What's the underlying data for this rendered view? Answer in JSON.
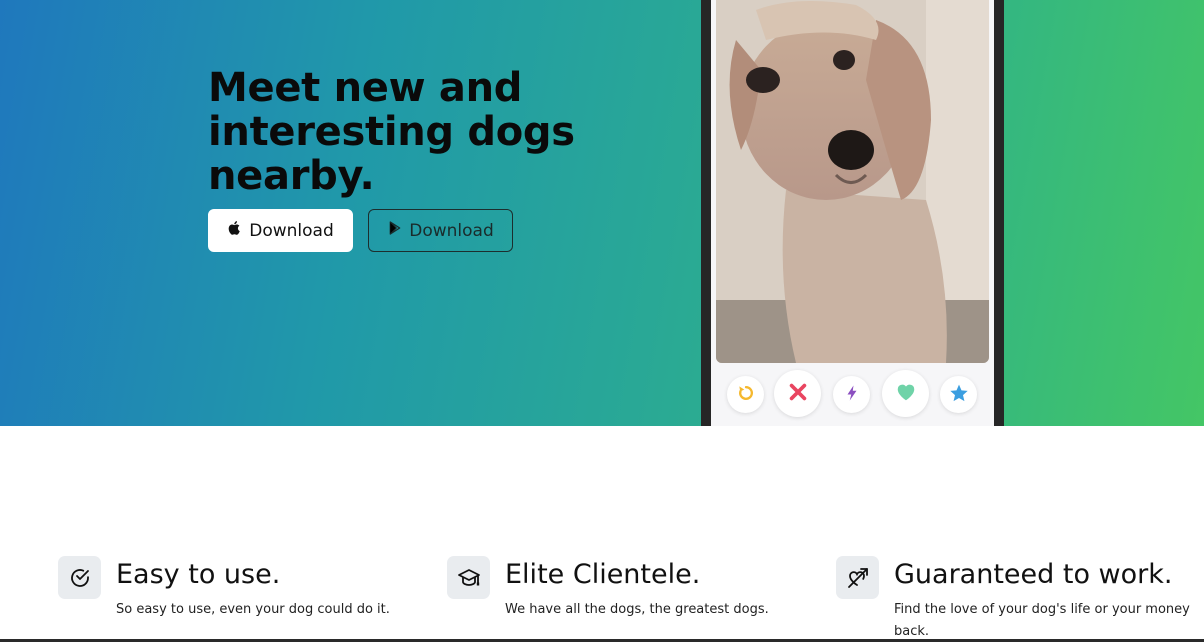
{
  "hero": {
    "title": "Meet new and interesting dogs nearby.",
    "apple_button_label": "Download",
    "play_button_label": "Download",
    "apple_icon": "apple-icon",
    "play_icon": "google-play-icon",
    "gradient_start": "#1f78bd",
    "gradient_end": "#44c665"
  },
  "phone": {
    "photo": "dog-photo",
    "actions": [
      {
        "name": "rewind-button",
        "icon": "rewind-icon",
        "color": "#f5b82e"
      },
      {
        "name": "nope-button",
        "icon": "close-icon",
        "color": "#e94560"
      },
      {
        "name": "boost-button",
        "icon": "lightning-icon",
        "color": "#8b4fc0"
      },
      {
        "name": "like-button",
        "icon": "heart-icon",
        "color": "#6fd3a8"
      },
      {
        "name": "super-like-button",
        "icon": "star-icon",
        "color": "#3b9ee0"
      }
    ]
  },
  "features": [
    {
      "icon": "check-circle-icon",
      "title": "Easy to use.",
      "text": "So easy to use, even your dog could do it."
    },
    {
      "icon": "graduation-cap-icon",
      "title": "Elite Clientele.",
      "text": "We have all the dogs, the greatest dogs."
    },
    {
      "icon": "heart-arrow-icon",
      "title": "Guaranteed to work.",
      "text": "Find the love of your dog's life or your money back."
    }
  ]
}
